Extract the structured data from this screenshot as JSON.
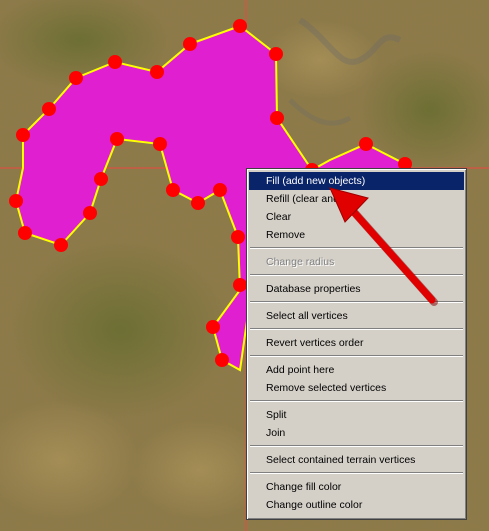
{
  "colors": {
    "polygon_fill": "#e020d0",
    "polygon_outline": "#ffff00",
    "vertex": "#ff0000",
    "crosshair": "#ff4040",
    "menu_bg": "#d4d0c8",
    "menu_highlight": "#0a246a",
    "annotation_arrow": "#e00000"
  },
  "icons": {
    "vertex": "red-dot-icon",
    "annotation": "red-arrow-icon"
  },
  "context_menu": {
    "items": [
      {
        "label": "Fill (add new objects)",
        "state": "highlighted"
      },
      {
        "label": "Refill (clear and fill)",
        "state": "normal"
      },
      {
        "label": "Clear",
        "state": "normal"
      },
      {
        "label": "Remove",
        "state": "normal"
      },
      {
        "label": "Change radius",
        "state": "disabled"
      },
      {
        "label": "Database properties",
        "state": "normal"
      },
      {
        "label": "Select all vertices",
        "state": "normal"
      },
      {
        "label": "Revert vertices order",
        "state": "normal"
      },
      {
        "label": "Add point here",
        "state": "normal"
      },
      {
        "label": "Remove selected vertices",
        "state": "normal"
      },
      {
        "label": "Split",
        "state": "normal"
      },
      {
        "label": "Join",
        "state": "normal"
      },
      {
        "label": "Select contained terrain vertices",
        "state": "normal"
      },
      {
        "label": "Change fill color",
        "state": "normal"
      },
      {
        "label": "Change outline color",
        "state": "normal"
      }
    ]
  }
}
